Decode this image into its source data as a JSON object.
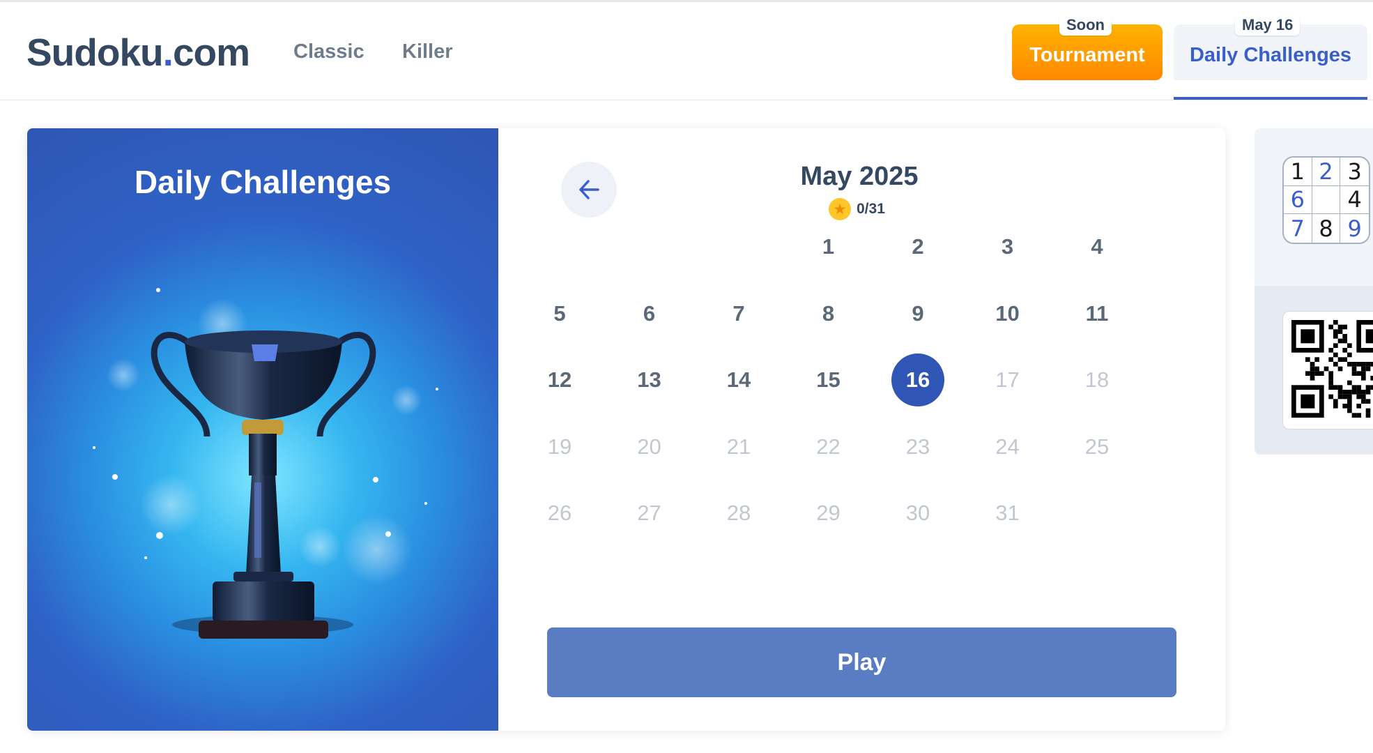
{
  "header": {
    "logo_main": "Sudoku",
    "logo_dot": ".",
    "logo_tld": "com",
    "nav": [
      {
        "label": "Classic"
      },
      {
        "label": "Killer"
      }
    ],
    "tournament_badge": "Soon",
    "tournament_label": "Tournament",
    "daily_badge": "May 16",
    "daily_label": "Daily Challenges",
    "accent_color": "#3a5fcd",
    "tournament_color": "#ff9800"
  },
  "challenge": {
    "panel_title": "Daily Challenges",
    "illustration": "trophy",
    "back_icon": "arrow-left-icon",
    "month_title": "May 2025",
    "progress_icon": "star-icon",
    "progress": "0/31",
    "first_weekday_index": 3,
    "current_day": 16,
    "days": [
      "1",
      "2",
      "3",
      "4",
      "5",
      "6",
      "7",
      "8",
      "9",
      "10",
      "11",
      "12",
      "13",
      "14",
      "15",
      "16",
      "17",
      "18",
      "19",
      "20",
      "21",
      "22",
      "23",
      "24",
      "25",
      "26",
      "27",
      "28",
      "29",
      "30",
      "31"
    ],
    "play_label": "Play"
  },
  "side": {
    "grid_digits": [
      "1",
      "2",
      "3",
      "6",
      "",
      "4",
      "7",
      "8",
      "9"
    ],
    "grid_blue": [
      false,
      true,
      false,
      true,
      false,
      false,
      true,
      false,
      true
    ],
    "qr_icon": "qr-code-icon"
  }
}
